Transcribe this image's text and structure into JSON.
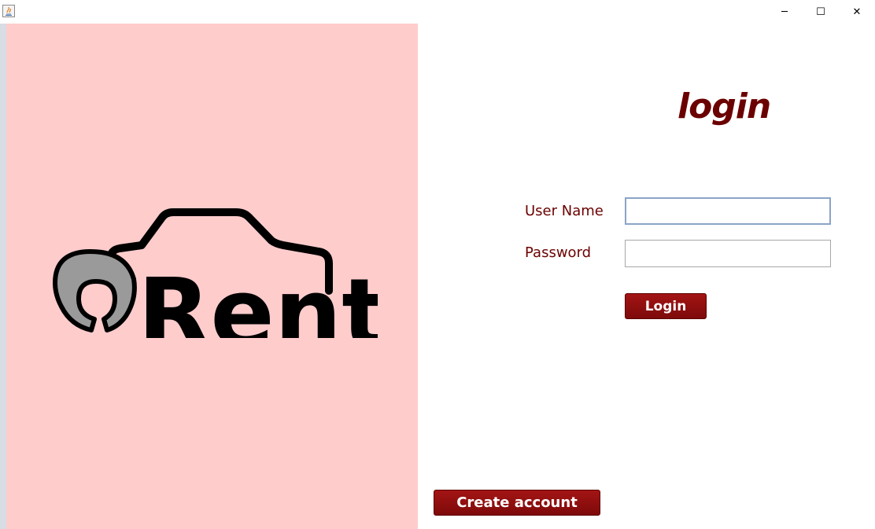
{
  "window": {
    "minimize_glyph": "─",
    "maximize_glyph": "☐",
    "close_glyph": "✕"
  },
  "branding": {
    "logo_text": "Rent",
    "panel_color": "#ffcccc"
  },
  "form": {
    "title": "login",
    "username_label": "User Name",
    "username_value": "",
    "password_label": "Password",
    "password_value": "",
    "login_button": "Login"
  },
  "footer": {
    "create_account_button": "Create account"
  },
  "colors": {
    "accent": "#6b0000",
    "button": "#8b0d0d"
  }
}
